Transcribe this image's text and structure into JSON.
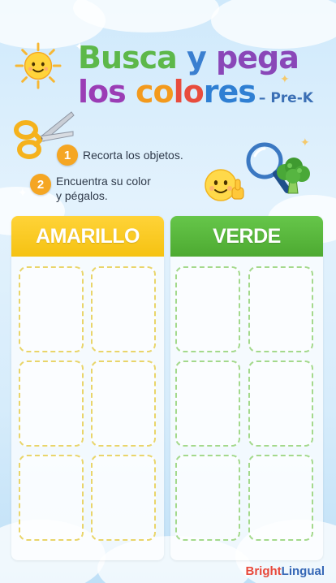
{
  "title": {
    "line1_parts": [
      {
        "text": "Busca",
        "color": "#5db84a"
      },
      {
        "text": " y ",
        "color": "#3a7fd0"
      },
      {
        "text": "pega",
        "color": "#8a47b8"
      }
    ],
    "line2_parts": [
      {
        "text": "los ",
        "color": "#9b3db5"
      },
      {
        "text": "co",
        "color": "#f39a1d"
      },
      {
        "text": "lo",
        "color": "#e84c3d"
      },
      {
        "text": "res",
        "color": "#2f7fd3"
      }
    ],
    "grade": "– Pre-K"
  },
  "steps": [
    {
      "number": "1",
      "text": "Recorta los objetos."
    },
    {
      "number": "2",
      "text_line1": "Encuentra su color",
      "text_line2": "y pégalos."
    }
  ],
  "panels": [
    {
      "label": "AMARILLO",
      "color": "#f5c212"
    },
    {
      "label": "VERDE",
      "color": "#4daa31"
    }
  ],
  "brand": {
    "part1": "Bright",
    "part2": "Lingual",
    "color1": "#e8483a",
    "color2": "#3567b6"
  }
}
